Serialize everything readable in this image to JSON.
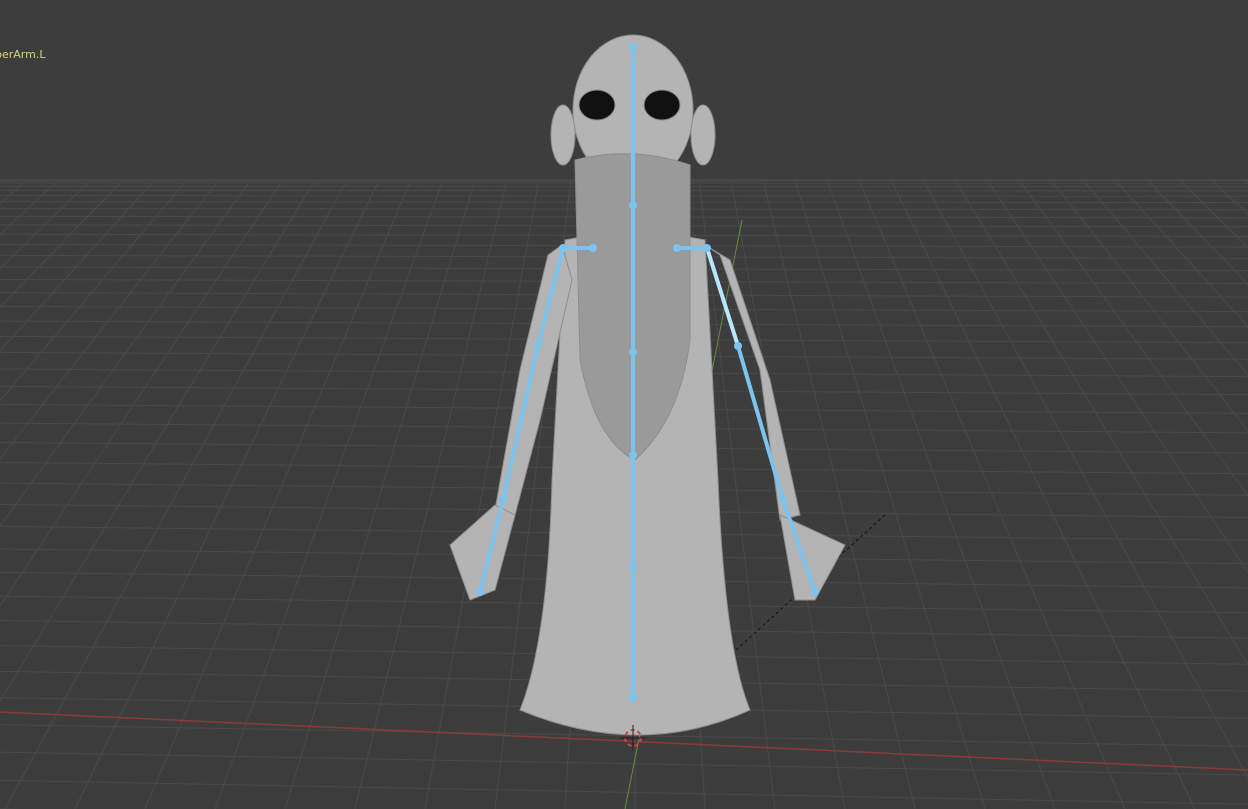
{
  "viewport": {
    "active_bone_label": "perArm.L",
    "colors": {
      "background": "#3d3d3d",
      "grid": "#4a4a4a",
      "x_axis": "#8a3a3a",
      "y_axis": "#6a8a3a",
      "bone": "#7cc4ee",
      "mesh": "#b8b8b8",
      "label": "#d8d870"
    }
  }
}
